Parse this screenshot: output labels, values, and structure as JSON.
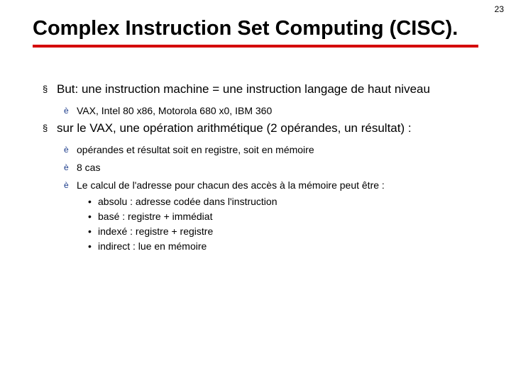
{
  "page_number": "23",
  "title": "Complex Instruction Set Computing (CISC).",
  "items": [
    {
      "text": "But: une instruction machine = une instruction langage de haut niveau",
      "sub": [
        {
          "text": "VAX, Intel 80 x86, Motorola 680 x0, IBM 360"
        }
      ]
    },
    {
      "text": "sur le VAX, une opération  arithmétique (2 opérandes, un résultat) :",
      "sub": [
        {
          "text": "opérandes et résultat  soit en registre, soit en mémoire"
        },
        {
          "text": "8 cas"
        },
        {
          "text": "Le calcul de l'adresse pour chacun des accès à la mémoire peut être  :",
          "dots": [
            "absolu : adresse codée dans l'instruction",
            "basé : registre + immédiat",
            "indexé : registre + registre",
            "indirect : lue en mémoire"
          ]
        }
      ]
    }
  ]
}
